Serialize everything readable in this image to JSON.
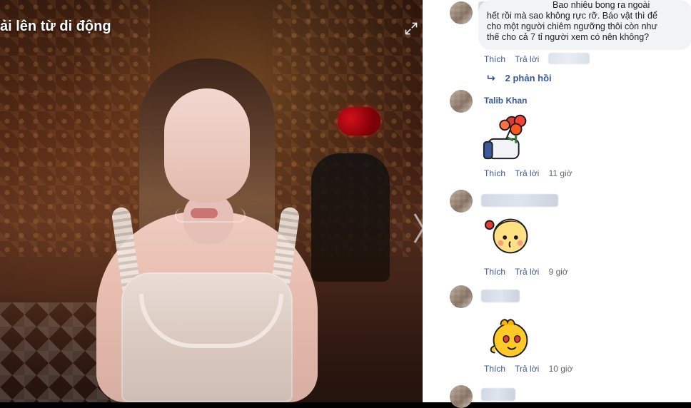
{
  "viewer": {
    "upload_label": "ải lên từ di động",
    "icons": {
      "expand": "expand-icon",
      "next": "chevron-right-icon"
    }
  },
  "comments": {
    "top_comment": {
      "lines": [
        "Bao nhiêu bong ra ngoài",
        "hết rồi mà sao không rực rỡ. Báo vật thì để",
        "cho một người chiêm ngưỡng thôi còn như",
        "thế cho cả 7 tỉ người xem có nên không?"
      ],
      "actions": {
        "like": "Thích",
        "reply": "Trả lời"
      },
      "replies": "2 phản hồi"
    },
    "items": [
      {
        "name": "Talib Khan",
        "actions": {
          "like": "Thích",
          "reply": "Trả lời",
          "time": "11 giờ"
        },
        "sticker": "flowers-like-sticker"
      },
      {
        "name": "",
        "actions": {
          "like": "Thích",
          "reply": "Trả lời",
          "time": "9 giờ"
        },
        "sticker": "kiss-girl-sticker"
      },
      {
        "name": "",
        "actions": {
          "like": "Thích",
          "reply": "Trả lời",
          "time": "10 giờ"
        },
        "sticker": "heart-eyes-chick-sticker"
      }
    ]
  },
  "colors": {
    "link": "#385898",
    "meta": "#616770",
    "bubble": "#f2f3f5",
    "text": "#1c1e21"
  }
}
